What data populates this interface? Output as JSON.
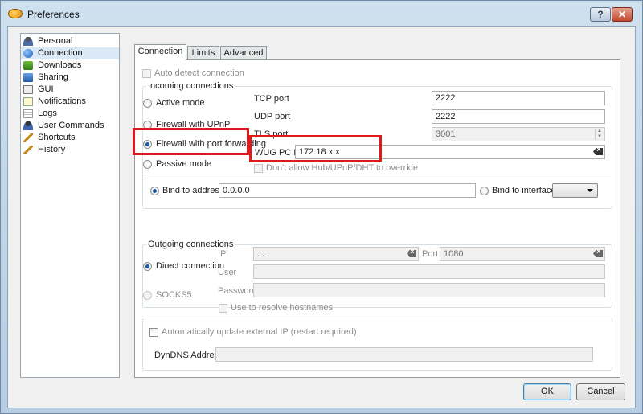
{
  "window": {
    "title": "Preferences",
    "help_label": "?",
    "close_label": "✕"
  },
  "sidebar": {
    "items": [
      {
        "label": "Personal",
        "icon": "person-icon"
      },
      {
        "label": "Connection",
        "icon": "connection-icon",
        "selected": true
      },
      {
        "label": "Downloads",
        "icon": "downloads-icon"
      },
      {
        "label": "Sharing",
        "icon": "sharing-icon"
      },
      {
        "label": "GUI",
        "icon": "gui-icon"
      },
      {
        "label": "Notifications",
        "icon": "notifications-icon"
      },
      {
        "label": "Logs",
        "icon": "logs-icon"
      },
      {
        "label": "User Commands",
        "icon": "user-icon"
      },
      {
        "label": "Shortcuts",
        "icon": "pencil-icon"
      },
      {
        "label": "History",
        "icon": "pencil-icon"
      }
    ]
  },
  "tabs": [
    {
      "label": "Connection",
      "active": true
    },
    {
      "label": "Limits",
      "active": false
    },
    {
      "label": "Advanced",
      "active": false
    }
  ],
  "connection": {
    "auto_detect_label": "Auto detect connection",
    "incoming": {
      "title": "Incoming connections",
      "active_mode": "Active mode",
      "firewall_upnp": "Firewall with UPnP",
      "firewall_port_forwarding": "Firewall with port forwarding",
      "passive_mode": "Passive mode",
      "selected_mode": "Firewall with port forwarding",
      "tcp_port_label": "TCP port",
      "tcp_port": "2222",
      "udp_port_label": "UDP port",
      "udp_port": "2222",
      "tls_port_label": "TLS port",
      "tls_port": "3001",
      "wug_ip_label": "WUG PC IP:",
      "wug_ip": "172.18.x.x",
      "dont_allow_label": "Don't allow Hub/UPnP/DHT to override",
      "bind_address_label": "Bind to address",
      "bind_address": "0.0.0.0",
      "bind_interface_label": "Bind to interface",
      "bind_interface_value": ""
    },
    "outgoing": {
      "title": "Outgoing connections",
      "direct_label": "Direct connection",
      "socks5_label": "SOCKS5",
      "ip_label": "IP",
      "ip_value": ". . .",
      "port_label": "Port",
      "port_value": "1080",
      "user_label": "User",
      "password_label": "Password",
      "resolve_label": "Use to resolve hostnames"
    },
    "external_ip": {
      "auto_update_label": "Automatically update external IP (restart required)",
      "dyndns_label": "DynDNS Address:",
      "dyndns_value": ""
    }
  },
  "buttons": {
    "ok": "OK",
    "cancel": "Cancel"
  },
  "colors": {
    "highlight_box": "#e0191d",
    "selection": "#dbe8f6"
  }
}
